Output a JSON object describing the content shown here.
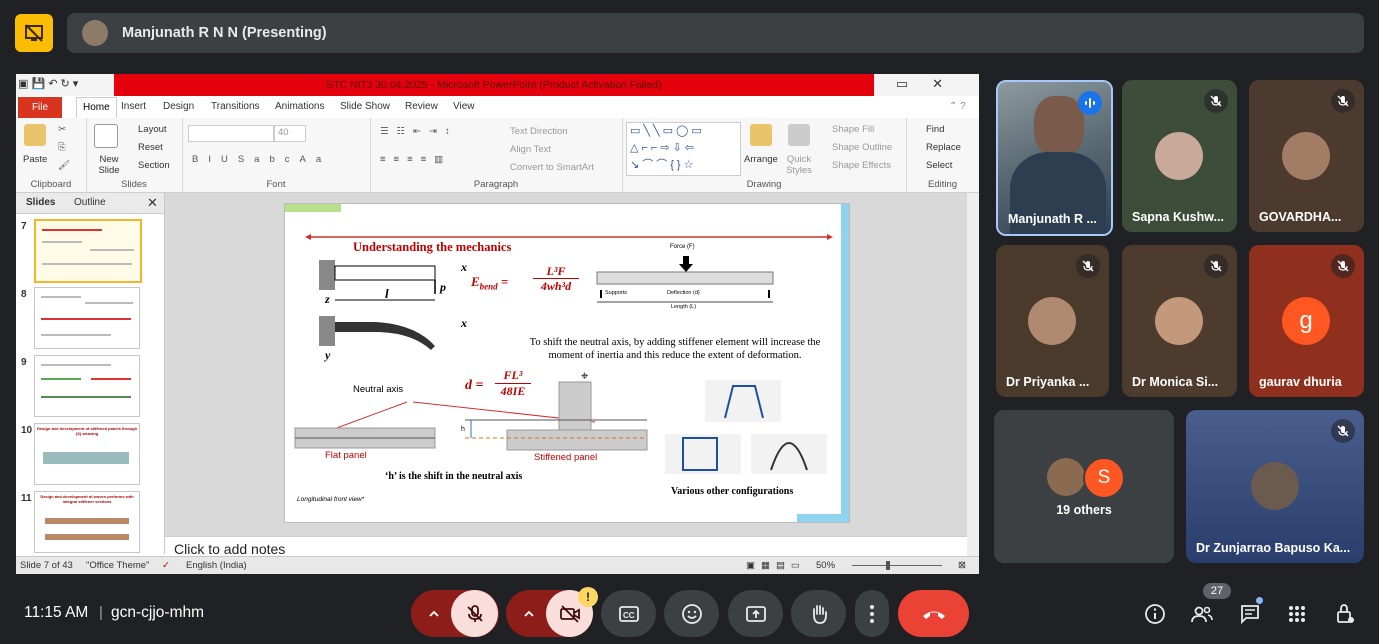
{
  "presenter_bar": {
    "name": "Manjunath R N N (Presenting)"
  },
  "powerpoint": {
    "window_title": "STC NITJ 30.04.2025  -  Microsoft PowerPoint (Product Activation Failed)",
    "tabs": [
      "File",
      "Home",
      "Insert",
      "Design",
      "Transitions",
      "Animations",
      "Slide Show",
      "Review",
      "View"
    ],
    "ribbon": {
      "clipboard": {
        "label": "Clipboard",
        "paste": "Paste"
      },
      "slides": {
        "label": "Slides",
        "new_slide": "New Slide",
        "layout": "Layout",
        "reset": "Reset",
        "section": "Section"
      },
      "font": {
        "label": "Font",
        "size": "40"
      },
      "paragraph": {
        "label": "Paragraph",
        "text_direction": "Text Direction",
        "align_text": "Align Text",
        "smartart": "Convert to SmartArt"
      },
      "drawing": {
        "label": "Drawing",
        "arrange": "Arrange",
        "quick_styles": "Quick Styles",
        "shape_fill": "Shape Fill",
        "shape_outline": "Shape Outline",
        "shape_effects": "Shape Effects"
      },
      "editing": {
        "label": "Editing",
        "find": "Find",
        "replace": "Replace",
        "select": "Select"
      }
    },
    "panel_tabs": {
      "slides": "Slides",
      "outline": "Outline"
    },
    "thumbnails": [
      {
        "num": "7"
      },
      {
        "num": "8"
      },
      {
        "num": "9"
      },
      {
        "num": "10",
        "caption": "Design and development of stiffened panels through (S) weaving"
      },
      {
        "num": "11",
        "caption": "Design and development of woven preforms with integral stiffener sections"
      }
    ],
    "slide": {
      "heading": "Understanding  the mechanics",
      "force_label": "Force (F)",
      "supports_label": "Supports",
      "deflection_label": "Deflection (d)",
      "length_label": "Length (L)",
      "axis_x": "x",
      "axis_z": "z",
      "axis_y": "y",
      "len_l": "l",
      "load_p": "p",
      "eq_bend_lhs": "E",
      "eq_bend_sub": "bend",
      "eq_bend_num": "L³F",
      "eq_bend_den": "4wh³d",
      "eq_d_lhs": "d =",
      "eq_d_num": "FL³",
      "eq_d_den": "48IE",
      "text_shift": "To shift the neutral axis, by adding stiffener element will increase the moment of inertia and this reduce the extent of deformation.",
      "neutral_axis": "Neutral axis",
      "flat_panel": "Flat panel",
      "stiffened_panel": "Stiffened panel",
      "h_caption": "‘h’ is the shift in the neutral axis",
      "h_label": "h",
      "various": "Various other configurations",
      "footnote": "Longitudinal front view*"
    },
    "notes_placeholder": "Click to add notes",
    "status": {
      "slide": "Slide 7 of 43",
      "theme": "\"Office Theme\"",
      "language": "English (India)",
      "zoom": "50%"
    }
  },
  "participants": [
    {
      "name": "Manjunath R ...",
      "speaking": true
    },
    {
      "name": "Sapna Kushw..."
    },
    {
      "name": "GOVARDHA..."
    },
    {
      "name": "Dr Priyanka ..."
    },
    {
      "name": "Dr Monica Si..."
    },
    {
      "name": "gaurav dhuria",
      "initial": "g"
    },
    {
      "name": "19 others",
      "initial": "S"
    },
    {
      "name": "Dr Zunjarrao Bapuso Ka..."
    }
  ],
  "bottom_bar": {
    "time": "11:15 AM",
    "separator": "|",
    "meeting_code": "gcn-cjjo-mhm",
    "participant_count": "27",
    "warning": "!"
  },
  "colors": {
    "meet_bg": "#202124",
    "accent_yellow": "#fbbc04",
    "end_call_red": "#ea4335",
    "slide_heading_red": "#c00000"
  }
}
